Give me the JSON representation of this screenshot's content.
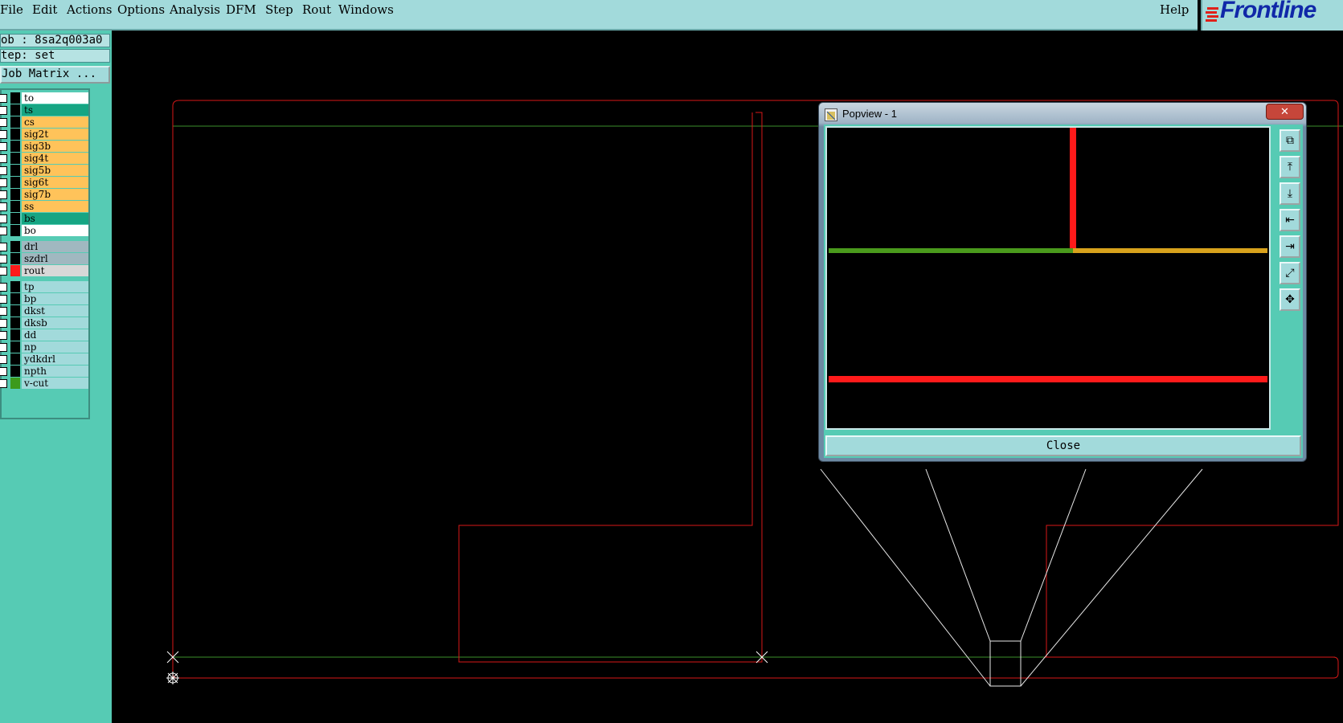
{
  "menubar": {
    "items": [
      "File",
      "Edit",
      "Actions",
      "Options",
      "Analysis",
      "DFM",
      "Step",
      "Rout",
      "Windows"
    ],
    "help": "Help"
  },
  "logo": {
    "text": "Frontline"
  },
  "info": {
    "job": "ob : 8sa2q003a0",
    "step": "tep: set"
  },
  "job_matrix": {
    "label": "Job Matrix ..."
  },
  "layers": [
    {
      "name": "to",
      "bg": "#ffffff",
      "swatch": "#000000"
    },
    {
      "name": "ts",
      "bg": "#16a583",
      "swatch": "#000000"
    },
    {
      "name": "cs",
      "bg": "#ffc35a",
      "swatch": "#000000"
    },
    {
      "name": "sig2t",
      "bg": "#ffc35a",
      "swatch": "#000000"
    },
    {
      "name": "sig3b",
      "bg": "#ffc35a",
      "swatch": "#000000"
    },
    {
      "name": "sig4t",
      "bg": "#ffc35a",
      "swatch": "#000000"
    },
    {
      "name": "sig5b",
      "bg": "#ffc35a",
      "swatch": "#000000"
    },
    {
      "name": "sig6t",
      "bg": "#ffc35a",
      "swatch": "#000000"
    },
    {
      "name": "sig7b",
      "bg": "#ffc35a",
      "swatch": "#000000"
    },
    {
      "name": "ss",
      "bg": "#ffc35a",
      "swatch": "#000000"
    },
    {
      "name": "bs",
      "bg": "#16a583",
      "swatch": "#000000"
    },
    {
      "name": "bo",
      "bg": "#ffffff",
      "swatch": "#000000"
    },
    {
      "name": "drl",
      "bg": "#a0b8c0",
      "swatch": "#000000"
    },
    {
      "name": "szdrl",
      "bg": "#a0b8c0",
      "swatch": "#000000"
    },
    {
      "name": "rout",
      "bg": "#d8d8d8",
      "swatch": "#ff1a1a"
    },
    {
      "name": "tp",
      "bg": "#a2dadb",
      "swatch": "#000000"
    },
    {
      "name": "bp",
      "bg": "#a2dadb",
      "swatch": "#000000"
    },
    {
      "name": "dkst",
      "bg": "#a2dadb",
      "swatch": "#000000"
    },
    {
      "name": "dksb",
      "bg": "#a2dadb",
      "swatch": "#000000"
    },
    {
      "name": "dd",
      "bg": "#a2dadb",
      "swatch": "#000000"
    },
    {
      "name": "np",
      "bg": "#a2dadb",
      "swatch": "#000000"
    },
    {
      "name": "ydkdrl",
      "bg": "#a2dadb",
      "swatch": "#000000"
    },
    {
      "name": "npth",
      "bg": "#a2dadb",
      "swatch": "#000000"
    },
    {
      "name": "v-cut",
      "bg": "#a2dadb",
      "swatch": "#3c9a1c"
    }
  ],
  "popview": {
    "title": "Popview - 1",
    "close_label": "Close",
    "tools": [
      "zoom-window-icon",
      "page-up-icon",
      "page-down-icon",
      "page-left-icon",
      "page-right-icon",
      "zoom-fit-icon",
      "zoom-home-icon"
    ]
  },
  "colors": {
    "rout": "#ff1a1a",
    "vcut": "#4a9a1c",
    "accent": "#56cbb4",
    "panel": "#a2dadb"
  }
}
